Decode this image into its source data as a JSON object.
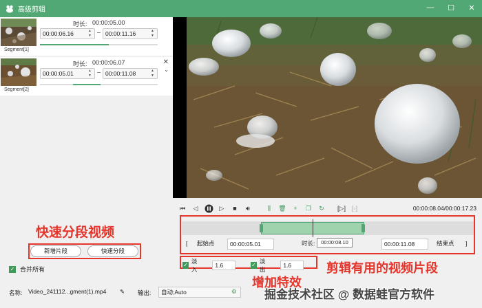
{
  "window": {
    "title": "高级剪辑",
    "minimize": "—",
    "maximize": "☐",
    "close": "✕"
  },
  "segments": [
    {
      "label": "Segment[1]",
      "duration_label": "时长:",
      "duration": "00:00:05.00",
      "start": "00:00:06.16",
      "end": "00:00:11.16"
    },
    {
      "label": "Segment[2]",
      "duration_label": "时长:",
      "duration": "00:00:06.07",
      "start": "00:00:05.01",
      "end": "00:00:11.08"
    }
  ],
  "left_actions": {
    "add_segment": "新增片段",
    "quick_split": "快速分段",
    "merge_all": "合并所有"
  },
  "player": {
    "time_readout": "00:00:08.04/00:00:17.23"
  },
  "range": {
    "start_label": "起始点",
    "start_value": "00:00:05.01",
    "duration_label": "时长:",
    "end_value": "00:00:11.08",
    "end_label": "结束点",
    "tooltip": "00:00:08.10"
  },
  "effects": {
    "fade_in_label": "淡入",
    "fade_in_value": "1.6",
    "fade_out_label": "淡出",
    "fade_out_value": "1.6"
  },
  "footer": {
    "name_label": "名称:",
    "name_value": "Video_241112...gment(1).mp4",
    "output_label": "输出:",
    "output_value": "自动;Auto"
  },
  "annotations": {
    "quick_segment": "快速分段视频",
    "trim_useful": "剪辑有用的视频片段",
    "add_effects": "增加特效"
  },
  "watermark": "掘金技术社区 @ 数据蛙官方软件",
  "colors": {
    "accent": "#51a874",
    "annotation_red": "#e5342a"
  }
}
